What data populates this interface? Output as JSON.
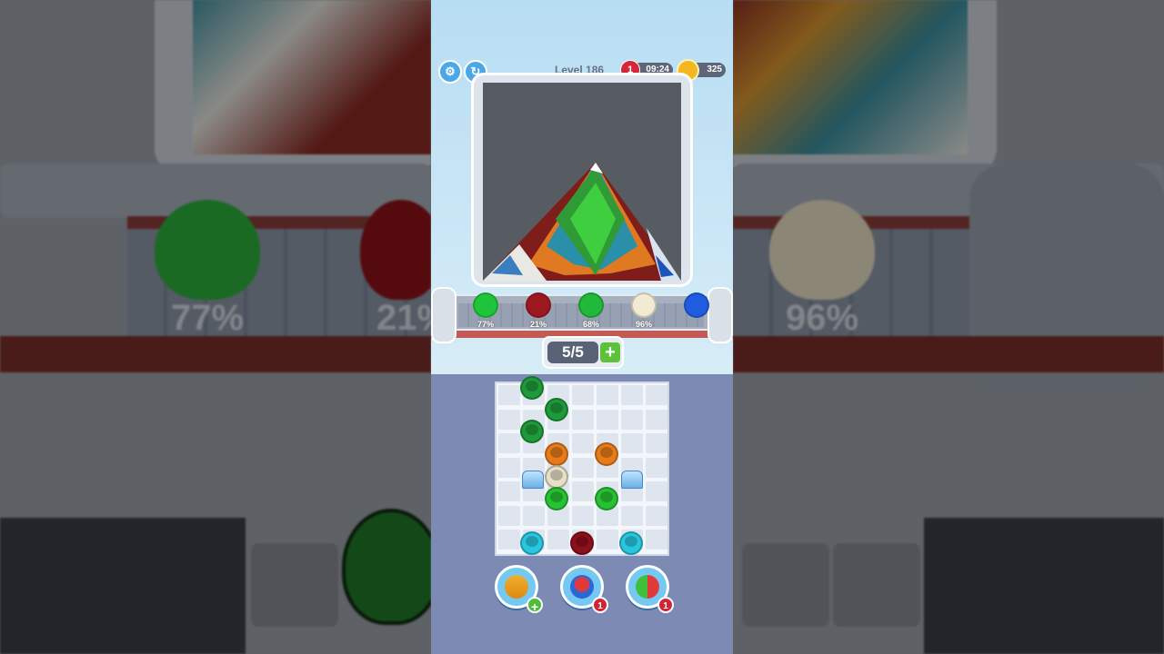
{
  "hud": {
    "settings_icon": "gear-icon",
    "restart_icon": "restart-icon",
    "level_label": "Level 186",
    "lives": "1",
    "timer": "09:24",
    "coins": "325"
  },
  "shelf": {
    "cups": [
      {
        "color": "#1fc43a",
        "percent": "77%"
      },
      {
        "color": "#9e1820",
        "percent": "21%"
      },
      {
        "color": "#22b83a",
        "percent": "68%"
      },
      {
        "color": "#f3ead2",
        "percent": "96%"
      },
      {
        "color": "#1f5ce0",
        "percent": ""
      }
    ]
  },
  "slots": {
    "value": "5/5",
    "add_label": "+"
  },
  "board": {
    "cups": [
      {
        "color": "#1f9a3a"
      },
      {
        "color": "#1f9a3a"
      },
      {
        "color": "#1f9a3a"
      },
      {
        "color": "#e77b1a"
      },
      {
        "color": "#e77b1a"
      },
      {
        "color": "#e7e0c6"
      },
      {
        "color": "#27c233"
      },
      {
        "color": "#27c233"
      },
      {
        "color": "#28c7df"
      },
      {
        "color": "#8d0f1a"
      },
      {
        "color": "#28c7df"
      }
    ]
  },
  "powerups": [
    {
      "name": "paint-bucket-icon",
      "badge": "+"
    },
    {
      "name": "magnet-icon",
      "badge": "1"
    },
    {
      "name": "shuffle-icon",
      "badge": "1"
    }
  ],
  "background": {
    "left_percents": [
      "77%",
      "21%"
    ],
    "right_percents": [
      "96%"
    ]
  }
}
